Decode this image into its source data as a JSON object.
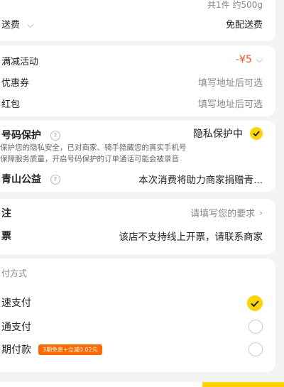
{
  "top": {
    "count_weight": "共1件 约500g",
    "delivery_label": "送费",
    "delivery_value": "免配送费"
  },
  "discounts": {
    "manjian_label": "满减活动",
    "manjian_value": "-¥5",
    "coupon_label": "优惠券",
    "coupon_value": "填写地址后可选",
    "redpacket_label": "红包",
    "redpacket_value": "填写地址后可选"
  },
  "privacy": {
    "label": "号码保护",
    "status": "隐私保护中",
    "desc_line1": "保护您的隐私安全，已对商家、骑手隐藏您的真实手机号",
    "desc_line2": "保障服务质量，开启号码保护的订单通话可能会被录音",
    "charity_label": "青山公益",
    "charity_value": "本次消费将助力商家捐赠青..."
  },
  "remarks": {
    "note_label": "注",
    "note_value": "请填写您的要求",
    "invoice_label": "票",
    "invoice_value": "该店不支持线上开票，请联系商家"
  },
  "payment": {
    "title": "付方式",
    "options": [
      {
        "label": "速支付",
        "selected": true
      },
      {
        "label": "通支付",
        "selected": false
      },
      {
        "label": "期付款",
        "badge": "3期免息+立减0.02元",
        "selected": false
      }
    ]
  },
  "colors": {
    "accent": "#ffd400",
    "price": "#ff4d1a",
    "badge": "#ff6a00"
  },
  "icons": {
    "chevron": "chevron-right-icon",
    "help": "question-icon",
    "check": "check-icon"
  }
}
